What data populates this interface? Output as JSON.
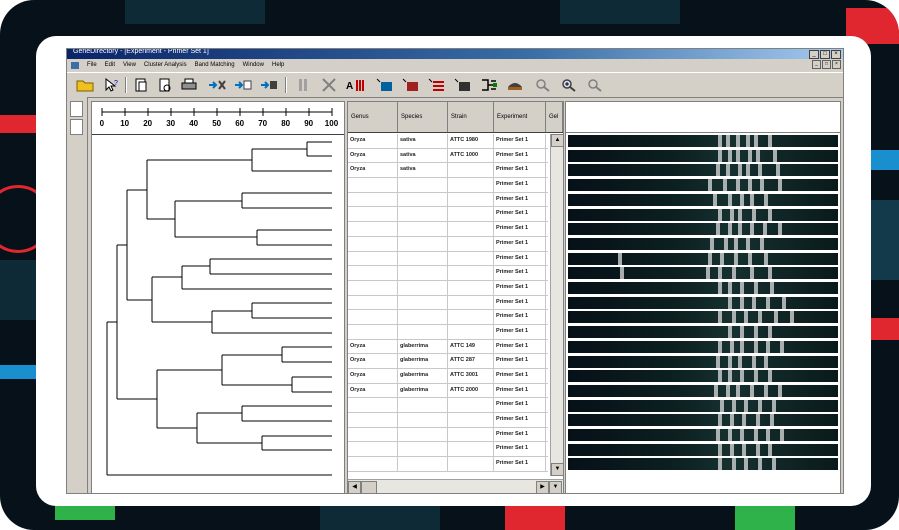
{
  "app": {
    "title": "GeneDirectory - [Experiment - Primer Set 1]",
    "window_controls": [
      "_",
      "□",
      "×"
    ],
    "mdi_controls": [
      "_",
      "□",
      "×"
    ]
  },
  "menu": [
    "File",
    "Edit",
    "View",
    "Cluster Analysis",
    "Band Matching",
    "Window",
    "Help"
  ],
  "toolbar": [
    {
      "icon": "open-folder-icon"
    },
    {
      "icon": "pointer-help-icon"
    },
    {
      "icon": "new-document-icon"
    },
    {
      "icon": "print-preview-icon"
    },
    {
      "icon": "print-icon"
    },
    {
      "icon": "arrow-add-icon"
    },
    {
      "icon": "arrow-insert-icon"
    },
    {
      "icon": "arrow-remove-icon"
    },
    {
      "icon": "gel-lane-icon"
    },
    {
      "icon": "gel-cross-icon"
    },
    {
      "icon": "band-ladder-icon"
    },
    {
      "icon": "band-match-blue-icon"
    },
    {
      "icon": "band-match-red-icon"
    },
    {
      "icon": "band-compare-icon"
    },
    {
      "icon": "band-normalize-icon"
    },
    {
      "icon": "tree-icon"
    },
    {
      "icon": "cluster-icon"
    },
    {
      "icon": "zoom-out-icon"
    },
    {
      "icon": "zoom-in-icon"
    },
    {
      "icon": "zoom-fit-icon"
    }
  ],
  "ruler": {
    "ticks": [
      "0",
      "10",
      "20",
      "30",
      "40",
      "50",
      "60",
      "70",
      "80",
      "90",
      "100"
    ]
  },
  "table": {
    "headers": [
      "Genus",
      "Species",
      "Strain",
      "Experiment",
      "Gel"
    ],
    "rows": [
      [
        "Oryza",
        "sativa",
        "ATTC 1980",
        "Primer Set 1"
      ],
      [
        "Oryza",
        "sativa",
        "ATTC 1000",
        "Primer Set 1"
      ],
      [
        "Oryza",
        "sativa",
        "",
        "Primer Set 1"
      ],
      [
        "",
        "",
        "",
        "Primer Set 1"
      ],
      [
        "",
        "",
        "",
        "Primer Set 1"
      ],
      [
        "",
        "",
        "",
        "Primer Set 1"
      ],
      [
        "",
        "",
        "",
        "Primer Set 1"
      ],
      [
        "",
        "",
        "",
        "Primer Set 1"
      ],
      [
        "",
        "",
        "",
        "Primer Set 1"
      ],
      [
        "",
        "",
        "",
        "Primer Set 1"
      ],
      [
        "",
        "",
        "",
        "Primer Set 1"
      ],
      [
        "",
        "",
        "",
        "Primer Set 1"
      ],
      [
        "",
        "",
        "",
        "Primer Set 1"
      ],
      [
        "",
        "",
        "",
        "Primer Set 1"
      ],
      [
        "Oryza",
        "glaberrima",
        "ATTC 149",
        "Primer Set 1"
      ],
      [
        "Oryza",
        "glaberrima",
        "ATTC 287",
        "Primer Set 1"
      ],
      [
        "Oryza",
        "glaberrima",
        "ATTC 3001",
        "Primer Set 1"
      ],
      [
        "Oryza",
        "glaberrima",
        "ATTC 2000",
        "Primer Set 1"
      ],
      [
        "",
        "",
        "",
        "Primer Set 1"
      ],
      [
        "",
        "",
        "",
        "Primer Set 1"
      ],
      [
        "",
        "",
        "",
        "Primer Set 1"
      ],
      [
        "",
        "",
        "",
        "Primer Set 1"
      ],
      [
        "",
        "",
        "",
        "Primer Set 1"
      ]
    ]
  },
  "colors": {
    "background": "#07111a",
    "accent_red": "#e0262e",
    "accent_blue": "#1a8fd0",
    "accent_green": "#2fb24a"
  }
}
